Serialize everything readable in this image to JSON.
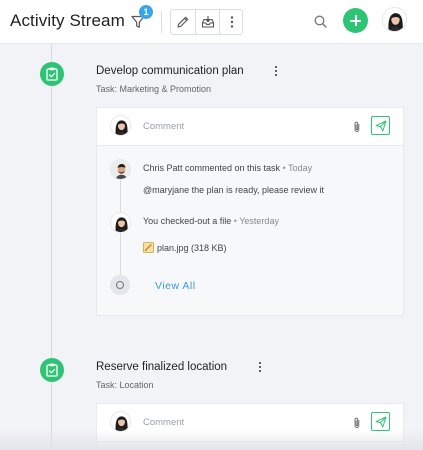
{
  "header": {
    "title": "Activity Stream",
    "filter_badge": "1",
    "icons": [
      "filter-icon",
      "pencil-icon",
      "inbox-download-icon",
      "more-vertical-icon",
      "search-icon",
      "plus-icon",
      "avatar"
    ]
  },
  "colors": {
    "accent_green": "#2ec375",
    "badge_blue": "#3ba6e6",
    "link_blue": "#3a9ad9"
  },
  "tasks": [
    {
      "title": "Develop communication plan",
      "subtitle": "Task: Marketing & Promotion",
      "comment_placeholder": "Comment",
      "activities": [
        {
          "text": "Chris Patt commented on this task",
          "separator": "•",
          "time": "Today",
          "body": "@maryjane the plan is ready, please review it"
        },
        {
          "text": "You checked-out a file",
          "separator": "•",
          "time": "Yesterday",
          "file": "plan.jpg (318 KB)"
        }
      ],
      "view_all": "View All"
    },
    {
      "title": "Reserve finalized location",
      "subtitle": "Task: Location",
      "comment_placeholder": "Comment"
    }
  ]
}
